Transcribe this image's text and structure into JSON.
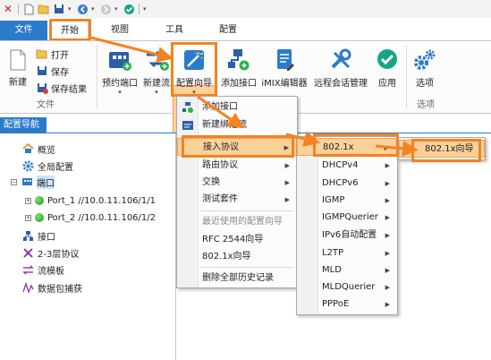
{
  "quick_access": {
    "icons": [
      "app-logo-icon",
      "new-file-icon",
      "open-folder-icon",
      "save-icon",
      "back-icon",
      "forward-icon",
      "apply-check-icon",
      "customize-icon"
    ]
  },
  "tabs": {
    "file": "文件",
    "home": "开始",
    "view": "视图",
    "tools": "工具",
    "config": "配置"
  },
  "ribbon": {
    "new": "新建",
    "open": "打开",
    "save": "保存",
    "save_result": "保存结果",
    "file_group": "文件",
    "reserve_port": "预约端口",
    "new_flow": "新建流",
    "config_wizard": "配置向导",
    "add_interface": "添加接口",
    "imix_editor": "iMIX编辑器",
    "remote_session": "远程会话管理",
    "apply": "应用",
    "options": "选项",
    "options_group": "选项"
  },
  "nav": {
    "tab": "配置导航",
    "items": {
      "overview": "概览",
      "global_config": "全局配置",
      "ports": "端口",
      "port1": "Port_1 //10.0.11.106/1/1",
      "port2": "Port_2 //10.0.11.106/1/2",
      "interface": "接口",
      "l23_protocol": "2-3层协议",
      "flow_template": "流模板",
      "capture": "数据包捕获"
    }
  },
  "menu1": {
    "add_interface": "添加接口",
    "new_bound_flow": "新建绑定流",
    "access_protocol": "接入协议",
    "routing_protocol": "路由协议",
    "switching": "交换",
    "test_suite": "测试套件",
    "recent_wizards": "最近使用的配置向导",
    "rfc2544": "RFC 2544向导",
    "dot1x_wizard": "802.1x向导",
    "delete_history": "删除全部历史记录"
  },
  "menu2": {
    "items": [
      "802.1x",
      "DHCPv4",
      "DHCPv6",
      "IGMP",
      "IGMPQuerier",
      "IPv6自动配置",
      "L2TP",
      "MLD",
      "MLDQuerier",
      "PPPoE"
    ]
  },
  "menu3": {
    "dot1x_wizard": "802.1x向导"
  },
  "colors": {
    "accent_blue": "#2c7bcb",
    "highlight_orange": "#f58220",
    "hover_fill": "#fbd19a"
  }
}
